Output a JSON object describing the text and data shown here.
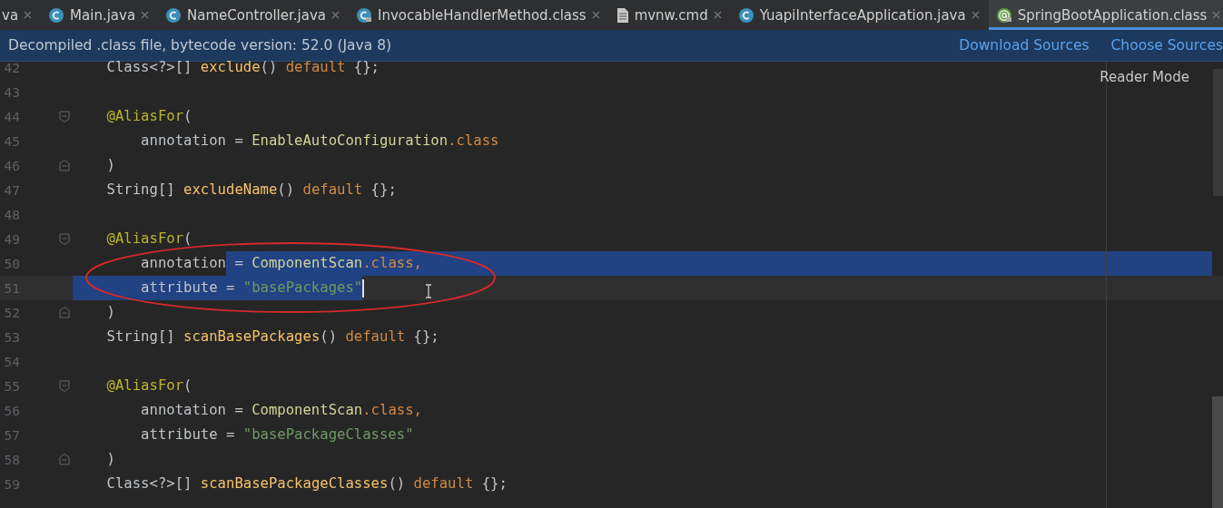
{
  "tabs": [
    {
      "label": "va",
      "kind": "plain",
      "locked": false,
      "selected": false
    },
    {
      "label": "Main.java",
      "kind": "class",
      "locked": false,
      "selected": false
    },
    {
      "label": "NameController.java",
      "kind": "class",
      "locked": false,
      "selected": false
    },
    {
      "label": "InvocableHandlerMethod.class",
      "kind": "class",
      "locked": true,
      "selected": false
    },
    {
      "label": "mvnw.cmd",
      "kind": "file",
      "locked": false,
      "selected": false
    },
    {
      "label": "YuapiInterfaceApplication.java",
      "kind": "class",
      "locked": false,
      "selected": false
    },
    {
      "label": "SpringBootApplication.class",
      "kind": "annotation",
      "locked": true,
      "selected": true
    }
  ],
  "banner": {
    "message": "Decompiled .class file, bytecode version: 52.0 (Java 8)",
    "links": [
      "Download Sources",
      "Choose Sources"
    ]
  },
  "reader_mode": "Reader Mode",
  "lines": [
    {
      "number": "42",
      "kind": "code",
      "current": false,
      "selection_to_end": false,
      "segments": [
        {
          "kind": "plain",
          "text": "    Class<?>[] "
        },
        {
          "kind": "method",
          "text": "exclude"
        },
        {
          "kind": "plain",
          "text": "() "
        },
        {
          "kind": "keyword",
          "text": "default"
        },
        {
          "kind": "plain",
          "text": " {};"
        }
      ]
    },
    {
      "number": "43",
      "kind": "code",
      "current": false,
      "selection_to_end": false
    },
    {
      "number": "44",
      "kind": "fold-start",
      "current": false,
      "selection_to_end": false,
      "segments": [
        {
          "kind": "annotation",
          "text": "    @AliasFor"
        },
        {
          "kind": "plain",
          "text": "("
        }
      ]
    },
    {
      "number": "45",
      "kind": "code",
      "current": false,
      "selection_to_end": false,
      "segments": [
        {
          "kind": "plain",
          "text": "        annotation = "
        },
        {
          "kind": "type",
          "text": "EnableAutoConfiguration"
        },
        {
          "kind": "keyword",
          "text": ".class"
        }
      ]
    },
    {
      "number": "46",
      "kind": "fold-end",
      "current": false,
      "selection_to_end": false,
      "segments": [
        {
          "kind": "plain",
          "text": "    )"
        }
      ]
    },
    {
      "number": "47",
      "kind": "code",
      "current": false,
      "selection_to_end": false,
      "segments": [
        {
          "kind": "plain",
          "text": "    String[] "
        },
        {
          "kind": "method",
          "text": "excludeName"
        },
        {
          "kind": "plain",
          "text": "() "
        },
        {
          "kind": "keyword",
          "text": "default"
        },
        {
          "kind": "plain",
          "text": " {};"
        }
      ]
    },
    {
      "number": "48",
      "kind": "code",
      "current": false,
      "selection_to_end": false
    },
    {
      "number": "49",
      "kind": "fold-start",
      "current": false,
      "selection_to_end": false,
      "segments": [
        {
          "kind": "annotation",
          "text": "    @AliasFor"
        },
        {
          "kind": "plain",
          "text": "("
        }
      ]
    },
    {
      "number": "50",
      "kind": "code",
      "current": false,
      "selection_to_end": true,
      "segments": [
        {
          "kind": "plain",
          "text": "        annotation",
          "selected": false
        },
        {
          "kind": "plain",
          "text": " = ",
          "selected": true
        },
        {
          "kind": "type",
          "text": "ComponentScan",
          "selected": true
        },
        {
          "kind": "keyword",
          "text": ".class,",
          "selected": true
        }
      ]
    },
    {
      "number": "51",
      "kind": "code",
      "current": true,
      "selection_to_end": false,
      "segments": [
        {
          "kind": "plain",
          "text": "        attribute = ",
          "selected": true
        },
        {
          "kind": "string",
          "text": "\"basePackages\"",
          "selected": true
        }
      ]
    },
    {
      "number": "52",
      "kind": "fold-end",
      "current": false,
      "selection_to_end": false,
      "segments": [
        {
          "kind": "plain",
          "text": "    )"
        }
      ]
    },
    {
      "number": "53",
      "kind": "code",
      "current": false,
      "selection_to_end": false,
      "segments": [
        {
          "kind": "plain",
          "text": "    String[] "
        },
        {
          "kind": "method",
          "text": "scanBasePackages"
        },
        {
          "kind": "plain",
          "text": "() "
        },
        {
          "kind": "keyword",
          "text": "default"
        },
        {
          "kind": "plain",
          "text": " {};"
        }
      ]
    },
    {
      "number": "54",
      "kind": "code",
      "current": false,
      "selection_to_end": false
    },
    {
      "number": "55",
      "kind": "fold-start",
      "current": false,
      "selection_to_end": false,
      "segments": [
        {
          "kind": "annotation",
          "text": "    @AliasFor"
        },
        {
          "kind": "plain",
          "text": "("
        }
      ]
    },
    {
      "number": "56",
      "kind": "code",
      "current": false,
      "selection_to_end": false,
      "segments": [
        {
          "kind": "plain",
          "text": "        annotation = "
        },
        {
          "kind": "type",
          "text": "ComponentScan"
        },
        {
          "kind": "keyword",
          "text": ".class,"
        }
      ]
    },
    {
      "number": "57",
      "kind": "code",
      "current": false,
      "selection_to_end": false,
      "segments": [
        {
          "kind": "plain",
          "text": "        attribute = "
        },
        {
          "kind": "string",
          "text": "\"basePackageClasses\""
        }
      ]
    },
    {
      "number": "58",
      "kind": "fold-end",
      "current": false,
      "selection_to_end": false,
      "segments": [
        {
          "kind": "plain",
          "text": "    )"
        }
      ]
    },
    {
      "number": "59",
      "kind": "code",
      "current": false,
      "selection_to_end": false,
      "segments": [
        {
          "kind": "plain",
          "text": "    Class<?>[] "
        },
        {
          "kind": "method",
          "text": "scanBasePackageClasses"
        },
        {
          "kind": "plain",
          "text": "() "
        },
        {
          "kind": "keyword",
          "text": "default"
        },
        {
          "kind": "plain",
          "text": " {};"
        }
      ]
    }
  ],
  "annotations": [
    {
      "kind": "ellipse",
      "color": "#d42a2a"
    }
  ]
}
